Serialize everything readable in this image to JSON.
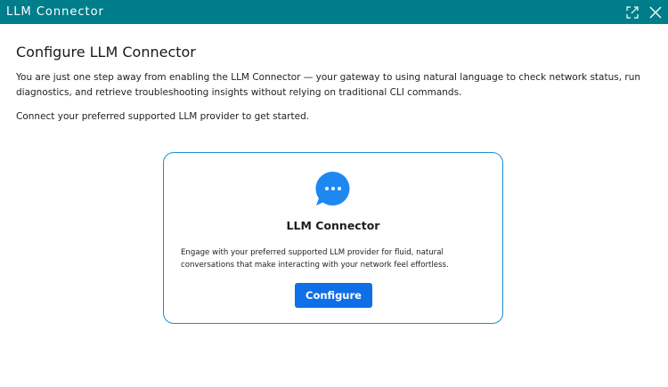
{
  "window": {
    "title": "LLM Connector",
    "expand_icon": "expand-icon",
    "close_icon": "close-icon",
    "titlebar_color": "#007d8a"
  },
  "main": {
    "heading": "Configure LLM Connector",
    "intro": "You are just one step away from enabling the LLM Connector — your gateway to using natural language to check network status, run diagnostics, and retrieve troubleshooting insights without relying on traditional CLI commands.",
    "connect_text": "Connect your preferred supported LLM provider to get started."
  },
  "card": {
    "icon": "chat-bubble-icon",
    "title": "LLM Connector",
    "description": "Engage with your preferred supported LLM provider for fluid, natural conversations that make interacting with your network feel effortless.",
    "button_label": "Configure",
    "accent_color": "#0f6fe8",
    "border_color": "#1a8fd0"
  }
}
